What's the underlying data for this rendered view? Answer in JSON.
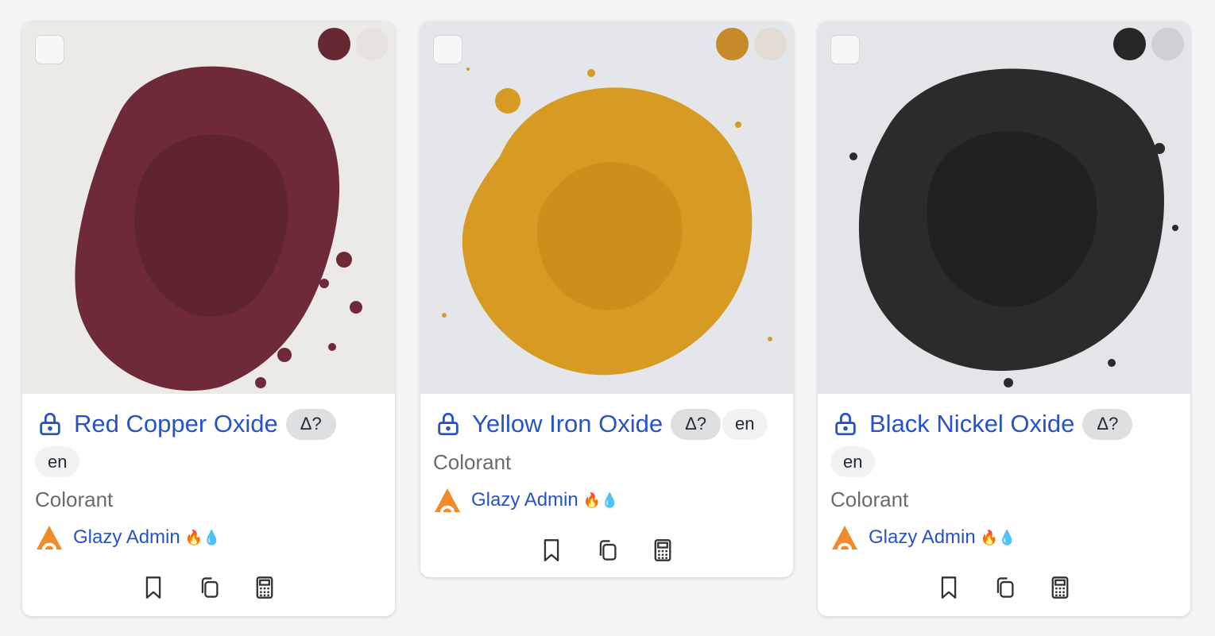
{
  "cards": [
    {
      "name": "Red Copper Oxide",
      "delta_badge": "Δ?",
      "language": "en",
      "category": "Colorant",
      "author": "Glazy Admin",
      "author_emoji": "🔥💧",
      "swatch_colors": [
        "#652931",
        "#e6e3df"
      ],
      "photo_colors": {
        "background": "#eceae6",
        "powder": "#6e2b37",
        "shade": "#4e1c24"
      }
    },
    {
      "name": "Yellow Iron Oxide",
      "delta_badge": "Δ?",
      "language": "en",
      "category": "Colorant",
      "author": "Glazy Admin",
      "author_emoji": "🔥💧",
      "swatch_colors": [
        "#c8892a",
        "#e2dbd3"
      ],
      "photo_colors": {
        "background": "#e5e6ea",
        "powder": "#d79a23",
        "shade": "#b77a12"
      }
    },
    {
      "name": "Black Nickel Oxide",
      "delta_badge": "Δ?",
      "language": "en",
      "category": "Colorant",
      "author": "Glazy Admin",
      "author_emoji": "🔥💧",
      "swatch_colors": [
        "#272727",
        "#cfd0d4"
      ],
      "photo_colors": {
        "background": "#e4e5e9",
        "powder": "#2b2b2b",
        "shade": "#161616"
      }
    }
  ],
  "icons": {
    "lock": "lock-icon",
    "author_logo": "glazy-logo-icon",
    "bookmark": "bookmark-icon",
    "copy": "copy-icon",
    "calculator": "calculator-icon"
  },
  "colors": {
    "link": "#2753c7",
    "muted": "#6b6b6b"
  }
}
